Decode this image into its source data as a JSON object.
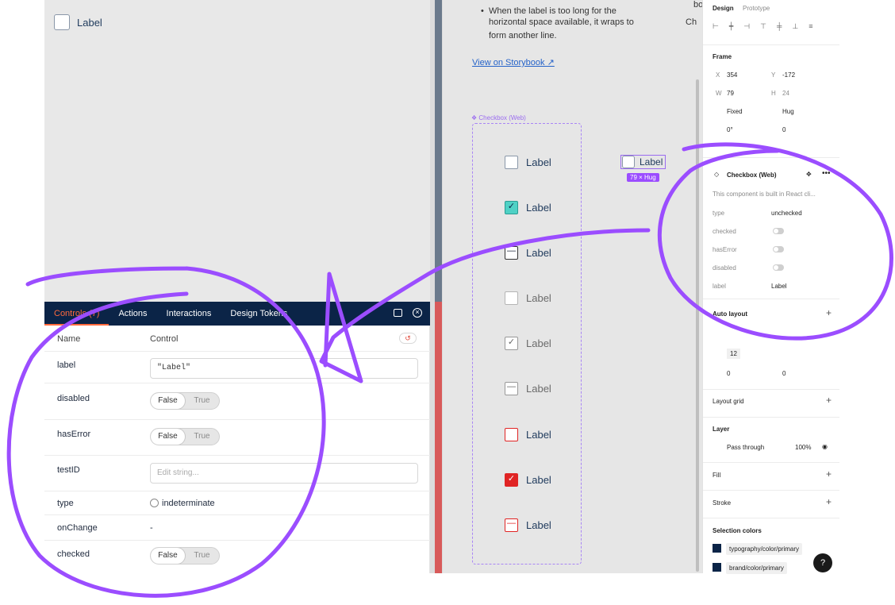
{
  "preview": {
    "checkbox_label": "Label"
  },
  "controls": {
    "tabs": [
      {
        "label": "Controls (7)"
      },
      {
        "label": "Actions"
      },
      {
        "label": "Interactions"
      },
      {
        "label": "Design Tokens"
      }
    ],
    "header": {
      "name": "Name",
      "control": "Control"
    },
    "rows": {
      "label": {
        "name": "label",
        "value": "\"Label\""
      },
      "disabled": {
        "name": "disabled",
        "false": "False",
        "true": "True"
      },
      "hasError": {
        "name": "hasError",
        "false": "False",
        "true": "True"
      },
      "testID": {
        "name": "testID",
        "placeholder": "Edit string..."
      },
      "type": {
        "name": "type",
        "value": "indeterminate"
      },
      "onChange": {
        "name": "onChange",
        "value": "-"
      },
      "checked": {
        "name": "checked",
        "false": "False",
        "true": "True"
      }
    }
  },
  "canvas": {
    "doc_text_1": "When the label is too long for the",
    "doc_text_2": "horizontal space available, it wraps to",
    "doc_text_3": "form another line.",
    "doc_bullet_right_1": "bo",
    "doc_bullet_right_2": "Ch",
    "storybook_link": "View on Storybook ↗",
    "frame_name": "❖ Checkbox (Web)",
    "checkbox_label": "Label",
    "selected_label": "Label",
    "size_badge": "79 × Hug"
  },
  "panel": {
    "tabs": {
      "design": "Design",
      "prototype": "Prototype"
    },
    "frame": {
      "title": "Frame",
      "x_label": "X",
      "x": "354",
      "y_label": "Y",
      "y": "-172",
      "w_label": "W",
      "w": "79",
      "h_label": "H",
      "h": "24",
      "w_mode": "Fixed",
      "h_mode": "Hug",
      "rotation": "0°",
      "radius": "0"
    },
    "component": {
      "title": "Checkbox (Web)",
      "desc": "This component is built in React cli...",
      "props": {
        "type_label": "type",
        "type_value": "unchecked",
        "checked_label": "checked",
        "hasError_label": "hasError",
        "disabled_label": "disabled",
        "label_label": "label",
        "label_value": "Label"
      }
    },
    "auto_layout": {
      "title": "Auto layout",
      "gap": "12",
      "pad_h": "0",
      "pad_v": "0"
    },
    "layout_grid": "Layout grid",
    "layer": {
      "title": "Layer",
      "blend": "Pass through",
      "opacity": "100%"
    },
    "fill": "Fill",
    "stroke": "Stroke",
    "selection_colors": {
      "title": "Selection colors",
      "c1": "typography/color/primary",
      "c2": "brand/color/primary"
    },
    "help": "?"
  },
  "colors": {
    "navy": "#0b2447",
    "accent": "#ff6a3d",
    "scribble": "#9b4dff",
    "teal": "#4fd1c5",
    "red": "#e02424"
  }
}
